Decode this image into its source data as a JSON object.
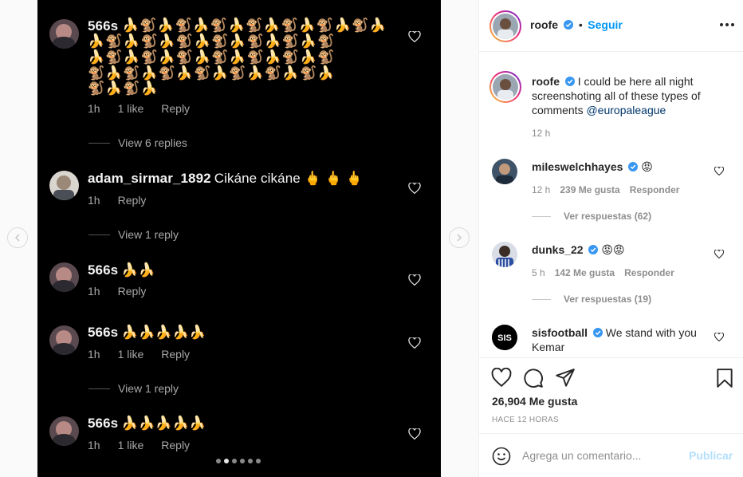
{
  "media": {
    "comments": [
      {
        "user": "566s",
        "text": "",
        "emoji_lines": [
          "🍌🐒🍌🐒🍌🐒🍌🐒🍌🐒🍌🐒🍌🐒🍌",
          "🍌🐒🍌🐒🍌🐒🍌🐒🍌🐒🍌🐒🍌🐒",
          "🍌🐒🍌🐒🍌🐒🍌🐒🍌🐒🍌🐒🍌🐒",
          "🐒🍌🐒🍌🐒🍌🐒🍌🐒🍌🐒🍌🐒🍌",
          "🐒🍌🐒🍌"
        ],
        "time": "1h",
        "likes": "1 like",
        "reply": "Reply",
        "view_replies": "View 6 replies"
      },
      {
        "user": "adam_sirmar_1892",
        "text": "Cikáne cikáne 🖕 🖕 🖕",
        "time": "1h",
        "likes": "",
        "reply": "Reply",
        "view_replies": "View 1 reply"
      },
      {
        "user": "566s",
        "text": "🍌🍌",
        "time": "1h",
        "likes": "",
        "reply": "Reply",
        "view_replies": ""
      },
      {
        "user": "566s",
        "text": "🍌🍌🍌🍌🍌",
        "time": "1h",
        "likes": "1 like",
        "reply": "Reply",
        "view_replies": "View 1 reply"
      },
      {
        "user": "566s",
        "text": "🍌🍌🍌🍌🍌",
        "time": "1h",
        "likes": "1 like",
        "reply": "Reply",
        "view_replies": ""
      }
    ],
    "carousel_index": 2,
    "carousel_total": 6
  },
  "post": {
    "author": "roofe",
    "follow_label": "Seguir",
    "separator": "•",
    "caption": "I could be here all night screenshoting all of these types of comments",
    "caption_mention": "@europaleague",
    "caption_time": "12 h",
    "comments": [
      {
        "user": "mileswelchhayes",
        "text": "😡",
        "time": "12 h",
        "likes": "239 Me gusta",
        "reply": "Responder",
        "view_replies": "Ver respuestas (62)"
      },
      {
        "user": "dunks_22",
        "text": "😡😡",
        "time": "5 h",
        "likes": "142 Me gusta",
        "reply": "Responder",
        "view_replies": "Ver respuestas (19)"
      },
      {
        "user": "sisfootball",
        "text": "We stand with you Kemar"
      }
    ],
    "likes_label": "26,904 Me gusta",
    "time_ago": "HACE 12 HORAS",
    "comment_placeholder": "Agrega un comentario...",
    "publish_label": "Publicar"
  },
  "colors": {
    "accent": "#0095f6",
    "verified": "#3897f0",
    "dark_bg": "#000000"
  }
}
